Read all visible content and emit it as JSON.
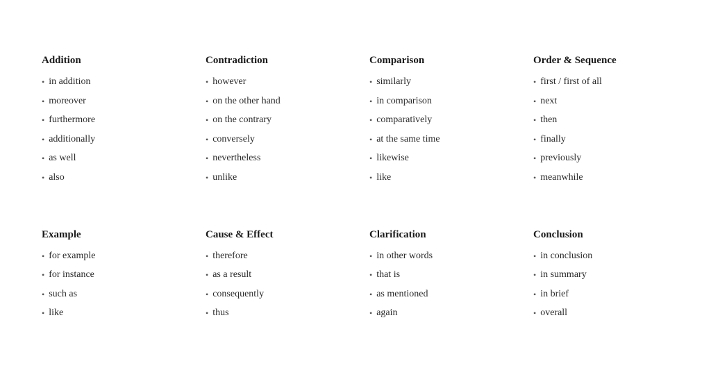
{
  "categories": [
    {
      "id": "addition",
      "title": "Addition",
      "items": [
        "in addition",
        "moreover",
        "furthermore",
        "additionally",
        "as well",
        "also"
      ]
    },
    {
      "id": "contradiction",
      "title": "Contradiction",
      "items": [
        "however",
        "on the other hand",
        "on the contrary",
        "conversely",
        "nevertheless",
        "unlike"
      ]
    },
    {
      "id": "comparison",
      "title": "Comparison",
      "items": [
        "similarly",
        "in comparison",
        "comparatively",
        "at the same time",
        "likewise",
        "like"
      ]
    },
    {
      "id": "order-sequence",
      "title": "Order & Sequence",
      "items": [
        "first / first of all",
        "next",
        "then",
        "finally",
        "previously",
        "meanwhile"
      ]
    },
    {
      "id": "example",
      "title": "Example",
      "items": [
        "for example",
        "for instance",
        "such as",
        "like"
      ]
    },
    {
      "id": "cause-effect",
      "title": "Cause & Effect",
      "items": [
        "therefore",
        "as a result",
        "consequently",
        "thus"
      ]
    },
    {
      "id": "clarification",
      "title": "Clarification",
      "items": [
        "in other words",
        "that is",
        "as mentioned",
        "again"
      ]
    },
    {
      "id": "conclusion",
      "title": "Conclusion",
      "items": [
        "in conclusion",
        "in summary",
        "in brief",
        "overall"
      ]
    }
  ]
}
